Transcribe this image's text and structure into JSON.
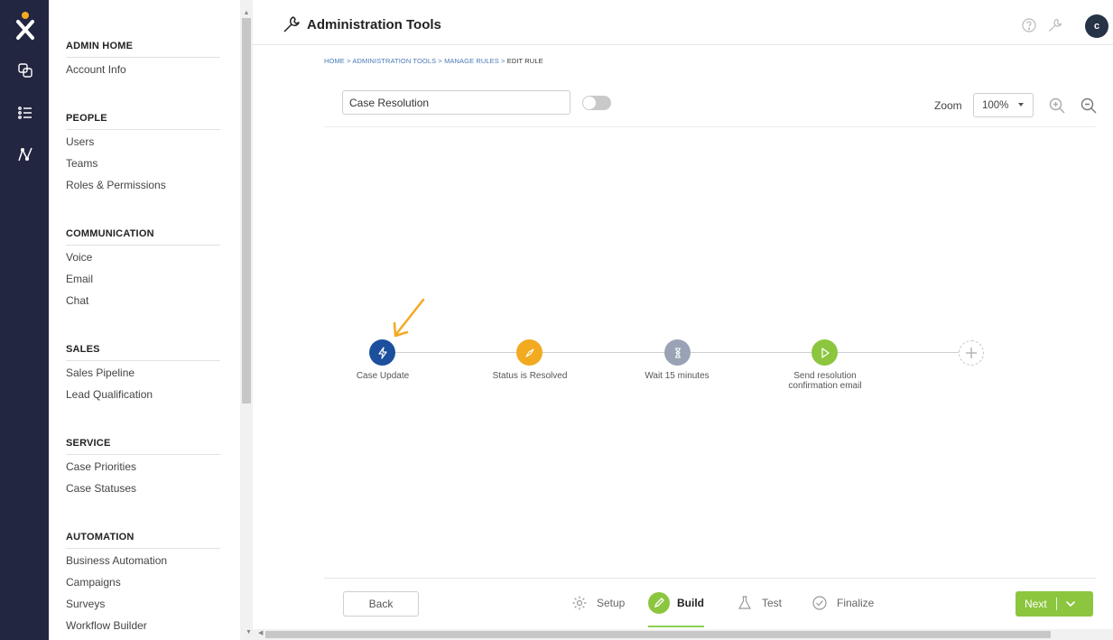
{
  "header": {
    "title": "Administration Tools",
    "avatar_initial": "c"
  },
  "sidebar": {
    "sections": [
      {
        "title": "ADMIN HOME",
        "items": [
          "Account Info"
        ]
      },
      {
        "title": "PEOPLE",
        "items": [
          "Users",
          "Teams",
          "Roles & Permissions"
        ]
      },
      {
        "title": "COMMUNICATION",
        "items": [
          "Voice",
          "Email",
          "Chat"
        ]
      },
      {
        "title": "SALES",
        "items": [
          "Sales Pipeline",
          "Lead Qualification"
        ]
      },
      {
        "title": "SERVICE",
        "items": [
          "Case Priorities",
          "Case Statuses"
        ]
      },
      {
        "title": "AUTOMATION",
        "items": [
          "Business Automation",
          "Campaigns",
          "Surveys",
          "Workflow Builder"
        ]
      }
    ]
  },
  "breadcrumb": {
    "home": "HOME",
    "admin": "ADMINISTRATION TOOLS",
    "rules": "MANAGE RULES",
    "current": "EDIT RULE",
    "sep": ">"
  },
  "rule": {
    "name": "Case Resolution"
  },
  "zoom": {
    "label": "Zoom",
    "value": "100%"
  },
  "flow": {
    "nodes": [
      {
        "label": "Case Update",
        "color": "#1c4f9c",
        "icon": "lightning-icon"
      },
      {
        "label": "Status is Resolved",
        "color": "#f2aa21",
        "icon": "compass-icon"
      },
      {
        "label": "Wait 15 minutes",
        "color": "#9aa3b5",
        "icon": "hourglass-icon"
      },
      {
        "label": "Send resolution confirmation email",
        "color": "#8cc63f",
        "icon": "play-icon"
      }
    ]
  },
  "footer": {
    "back": "Back",
    "steps": {
      "setup": "Setup",
      "build": "Build",
      "test": "Test",
      "finalize": "Finalize"
    },
    "next": "Next"
  },
  "colors": {
    "rail": "#232640",
    "accent_green": "#8cc63f",
    "link_blue": "#4a79b8",
    "annotation_arrow": "#f2aa21"
  }
}
